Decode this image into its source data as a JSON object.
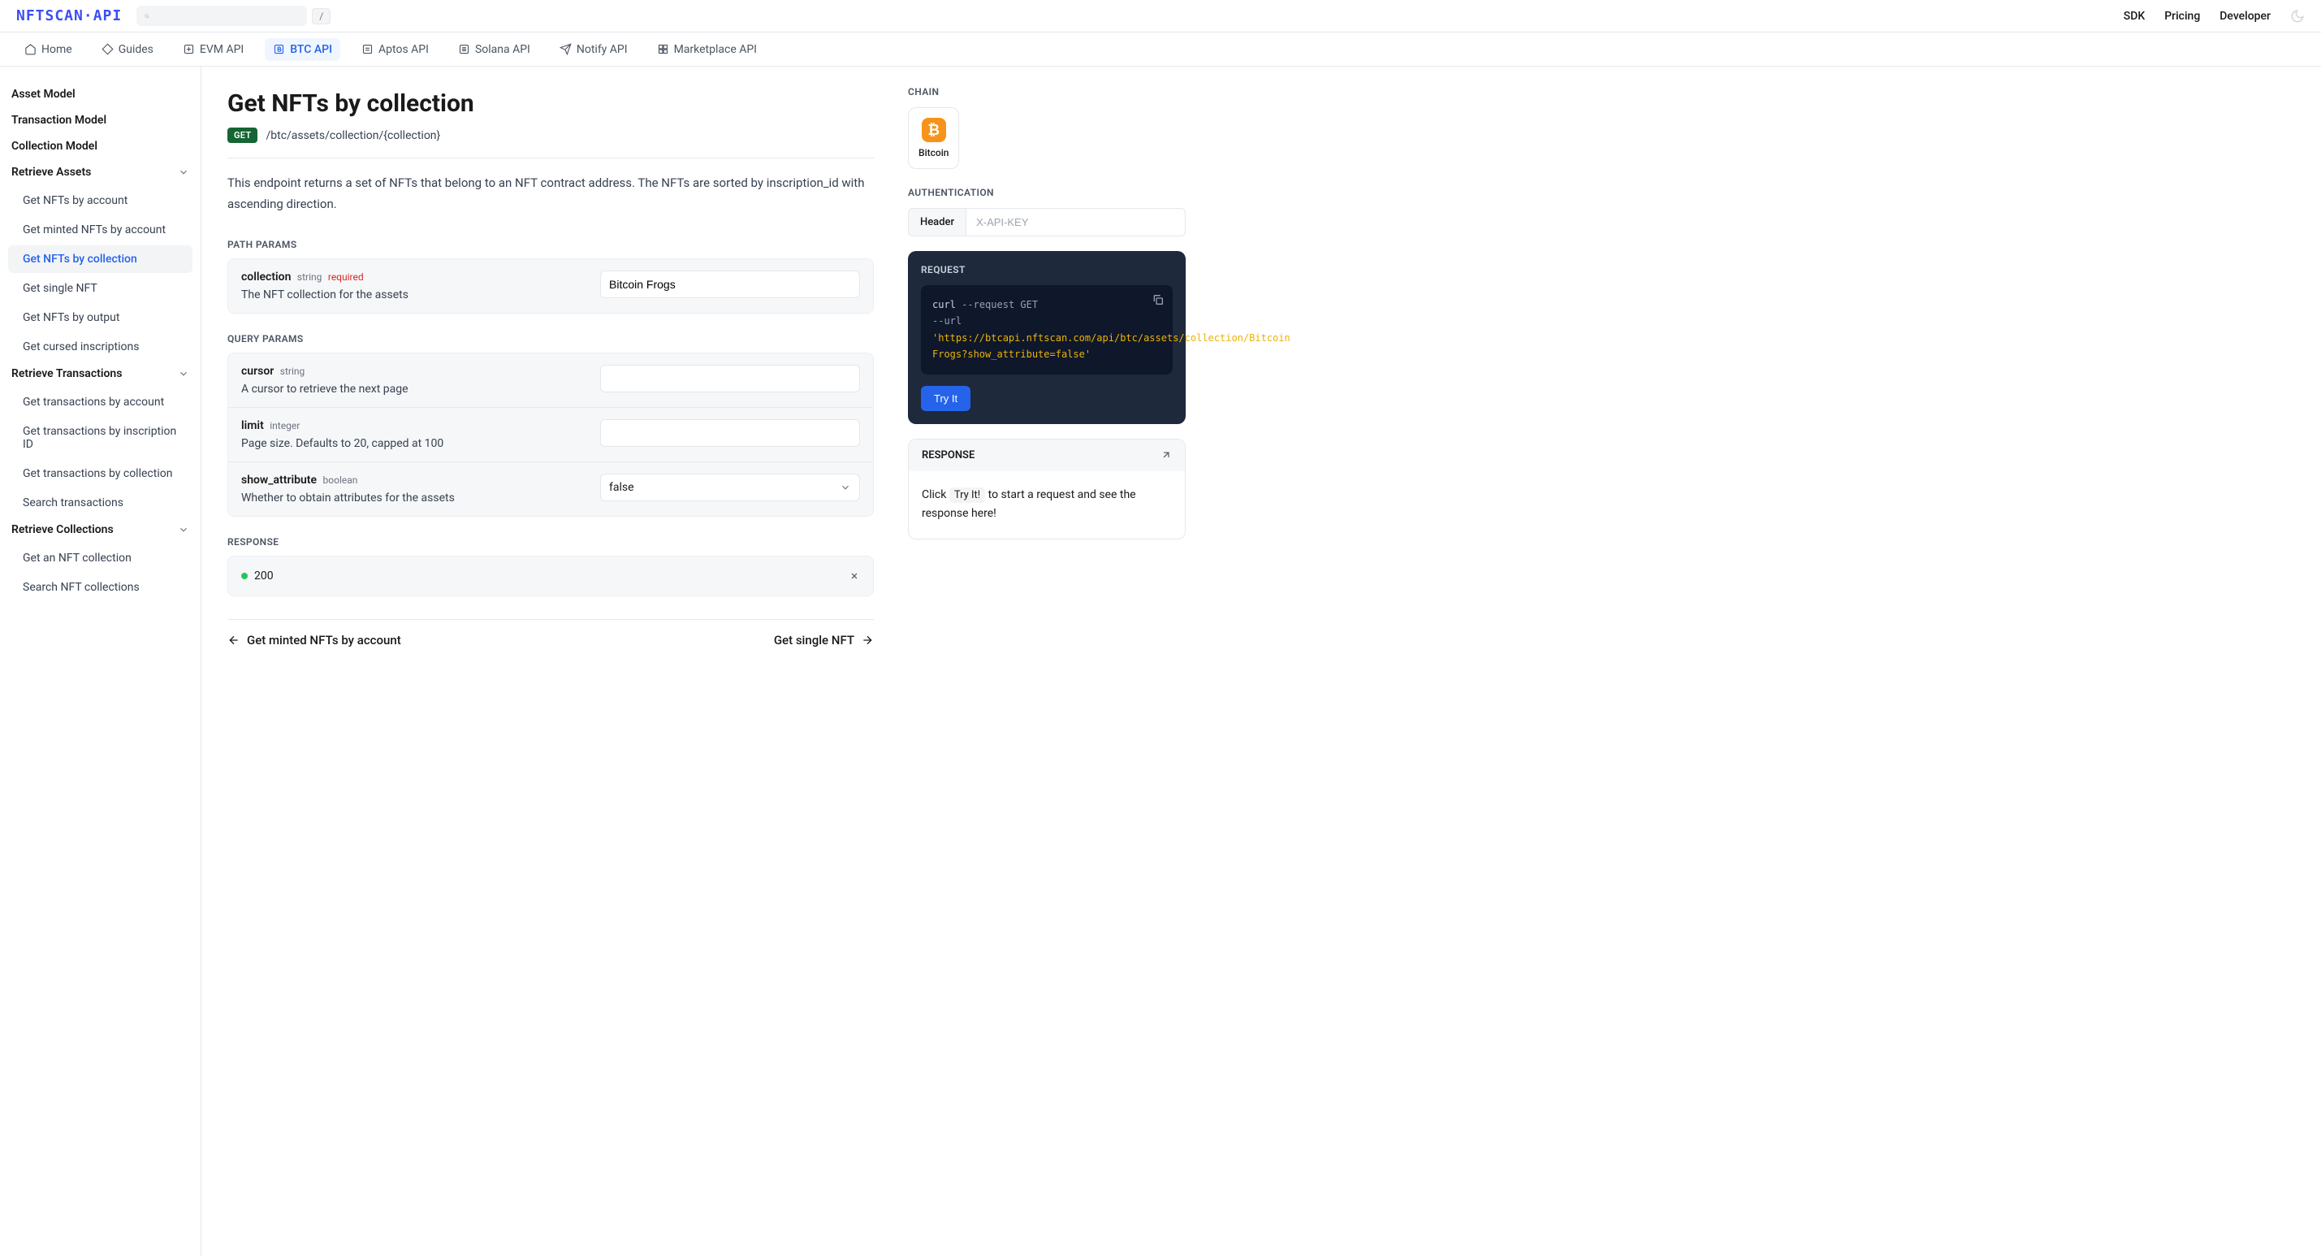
{
  "logo": "NFTSCAN·API",
  "search_placeholder": "",
  "slash_key": "/",
  "top_links": {
    "sdk": "SDK",
    "pricing": "Pricing",
    "developer": "Developer"
  },
  "nav": {
    "home": "Home",
    "guides": "Guides",
    "evm": "EVM API",
    "btc": "BTC API",
    "aptos": "Aptos API",
    "solana": "Solana API",
    "notify": "Notify API",
    "marketplace": "Marketplace API"
  },
  "sidebar": {
    "models": {
      "asset": "Asset Model",
      "transaction": "Transaction Model",
      "collection": "Collection Model"
    },
    "retrieve_assets": {
      "title": "Retrieve Assets",
      "items": {
        "by_account": "Get NFTs by account",
        "minted_by_account": "Get minted NFTs by account",
        "by_collection": "Get NFTs by collection",
        "single": "Get single NFT",
        "by_output": "Get NFTs by output",
        "cursed": "Get cursed inscriptions"
      }
    },
    "retrieve_tx": {
      "title": "Retrieve Transactions",
      "items": {
        "by_account": "Get transactions by account",
        "by_inscription": "Get transactions by inscription ID",
        "by_collection": "Get transactions by collection",
        "search": "Search transactions"
      }
    },
    "retrieve_coll": {
      "title": "Retrieve Collections",
      "items": {
        "get": "Get an NFT collection",
        "search": "Search NFT collections"
      }
    }
  },
  "page": {
    "title": "Get NFTs by collection",
    "method": "GET",
    "path": "/btc/assets/collection/{collection}",
    "description": "This endpoint returns a set of NFTs that belong to an NFT contract address. The NFTs are sorted by inscription_id with ascending direction.",
    "path_params_label": "PATH PARAMS",
    "query_params_label": "QUERY PARAMS",
    "response_label": "RESPONSE",
    "required_label": "required",
    "path_params": {
      "collection": {
        "name": "collection",
        "type": "string",
        "desc": "The NFT collection for the assets",
        "value": "Bitcoin Frogs"
      }
    },
    "query_params": {
      "cursor": {
        "name": "cursor",
        "type": "string",
        "desc": "A cursor to retrieve the next page",
        "value": ""
      },
      "limit": {
        "name": "limit",
        "type": "integer",
        "desc": "Page size. Defaults to 20, capped at 100",
        "value": ""
      },
      "show_attribute": {
        "name": "show_attribute",
        "type": "boolean",
        "desc": "Whether to obtain attributes for the assets",
        "value": "false"
      }
    },
    "response_code": "200",
    "prev": "Get minted NFTs by account",
    "next": "Get single NFT"
  },
  "right": {
    "chain_label": "CHAIN",
    "chain_name": "Bitcoin",
    "auth_label": "AUTHENTICATION",
    "auth_header": "Header",
    "auth_placeholder": "X-API-KEY",
    "request_label": "REQUEST",
    "code": {
      "curl": "curl",
      "req_flag": "--request GET",
      "url_flag": "--url",
      "url": "'https://btcapi.nftscan.com/api/btc/assets/collection/Bitcoin Frogs?show_attribute=false'"
    },
    "try_it": "Try It",
    "response_label": "RESPONSE",
    "response_hint_pre": "Click",
    "response_hint_btn": "Try It!",
    "response_hint_post": "to start a request and see the response here!"
  }
}
